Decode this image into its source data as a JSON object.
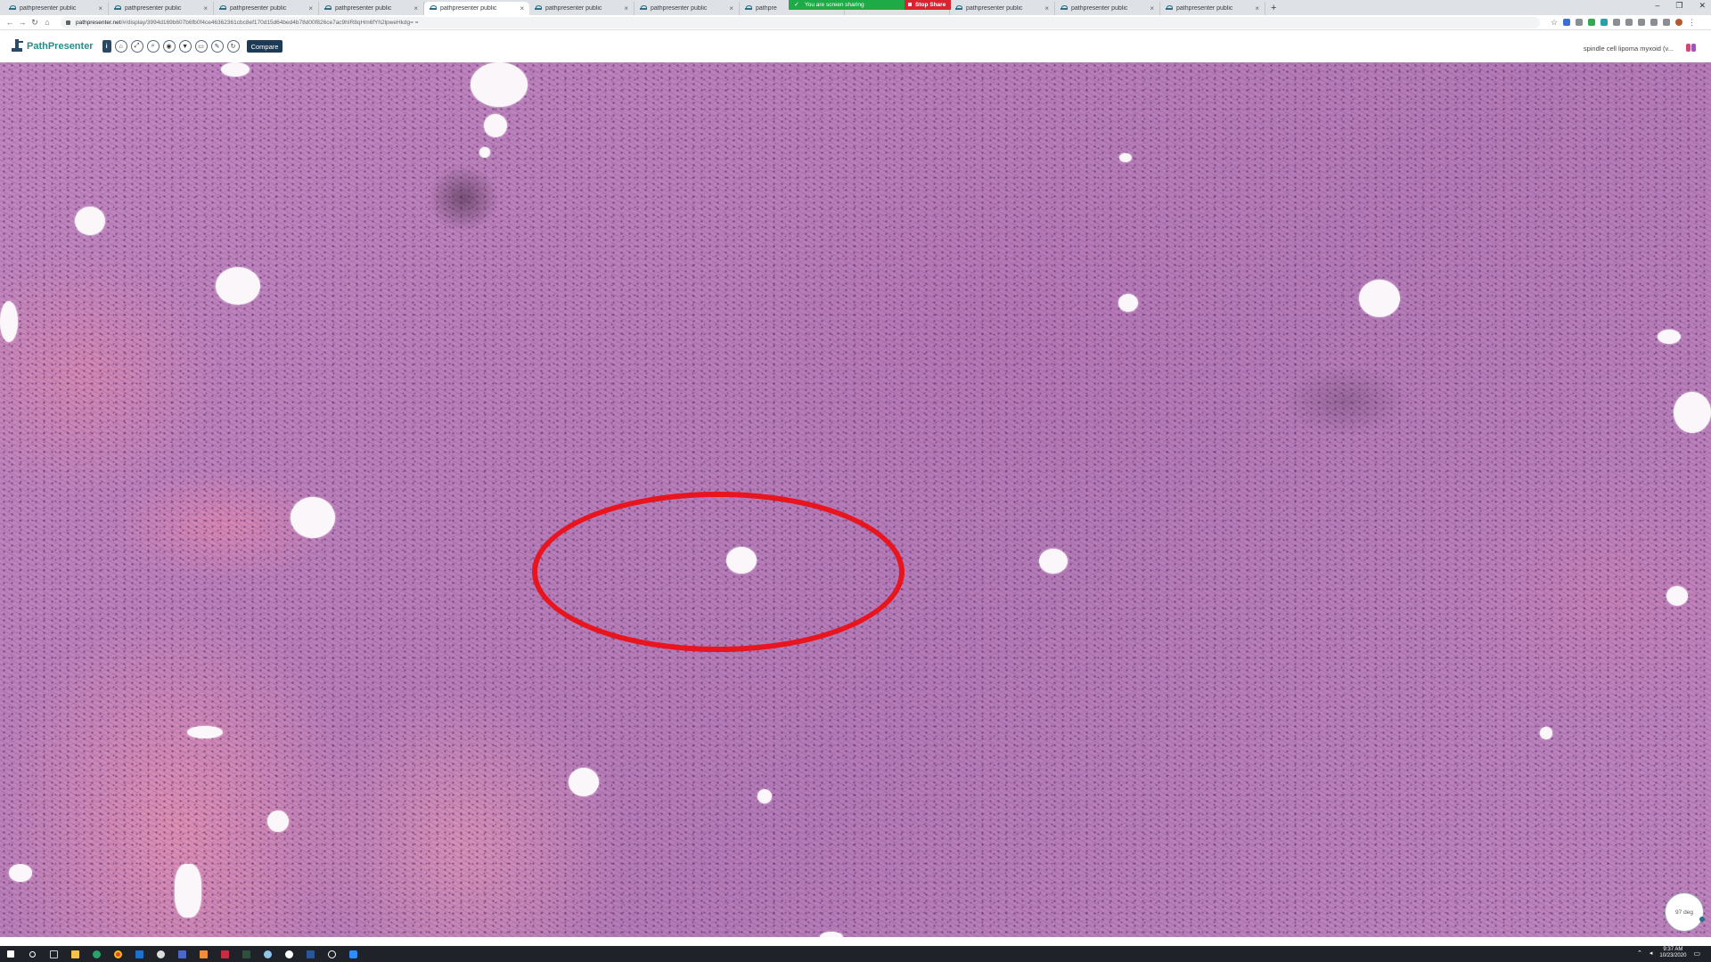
{
  "browser": {
    "tabs": [
      {
        "label": "pathpresenter public",
        "active": false
      },
      {
        "label": "pathpresenter public",
        "active": false
      },
      {
        "label": "pathpresenter public",
        "active": false
      },
      {
        "label": "pathpresenter public",
        "active": false
      },
      {
        "label": "pathpresenter public",
        "active": true
      },
      {
        "label": "pathpresenter public",
        "active": false
      },
      {
        "label": "pathpresenter public",
        "active": false
      },
      {
        "label": "pathpre",
        "active": false
      },
      {
        "label": "",
        "active": false
      },
      {
        "label": "pathpresenter public",
        "active": false
      },
      {
        "label": "pathpresenter public",
        "active": false
      },
      {
        "label": "pathpresenter public",
        "active": false
      }
    ],
    "tab_close": "×",
    "new_tab": "+",
    "window_controls": {
      "minimize": "–",
      "restore": "❐",
      "close": "✕"
    },
    "url_host": "pathpresenter.net",
    "url_path": "/#/display/3994d169b607b6fb0f4ce46362361cbc8ef170d15d64bed4b78d00f826ce7ac9hIR8qHm6fYh2lpweHkdg= ="
  },
  "screen_share": {
    "banner_text": "You are screen sharing",
    "stop_label": "Stop Share"
  },
  "app": {
    "name": "PathPresenter",
    "info_label": "i",
    "toolbar_icons": [
      "home-icon",
      "expand-icon",
      "zoom-icon",
      "camera-icon",
      "filter-icon",
      "monitor-icon",
      "pencil-icon",
      "rotate-icon"
    ],
    "compare_label": "Compare",
    "case_title": "spindle cell lipoma myxoid (v..."
  },
  "viewer": {
    "annotation": {
      "shape": "ellipse",
      "color": "#e8141e"
    },
    "rotation_label": "97 deg"
  },
  "taskbar": {
    "time": "9:37 AM",
    "date": "10/23/2020"
  },
  "colors": {
    "stain_pink": "#e690b0",
    "stain_purple": "#b47bb6",
    "nuclei": "#46195a",
    "brand_teal": "#2b8a8a",
    "compare_bg": "#1d3b57",
    "share_green": "#1faa48",
    "share_red": "#d9232e"
  }
}
